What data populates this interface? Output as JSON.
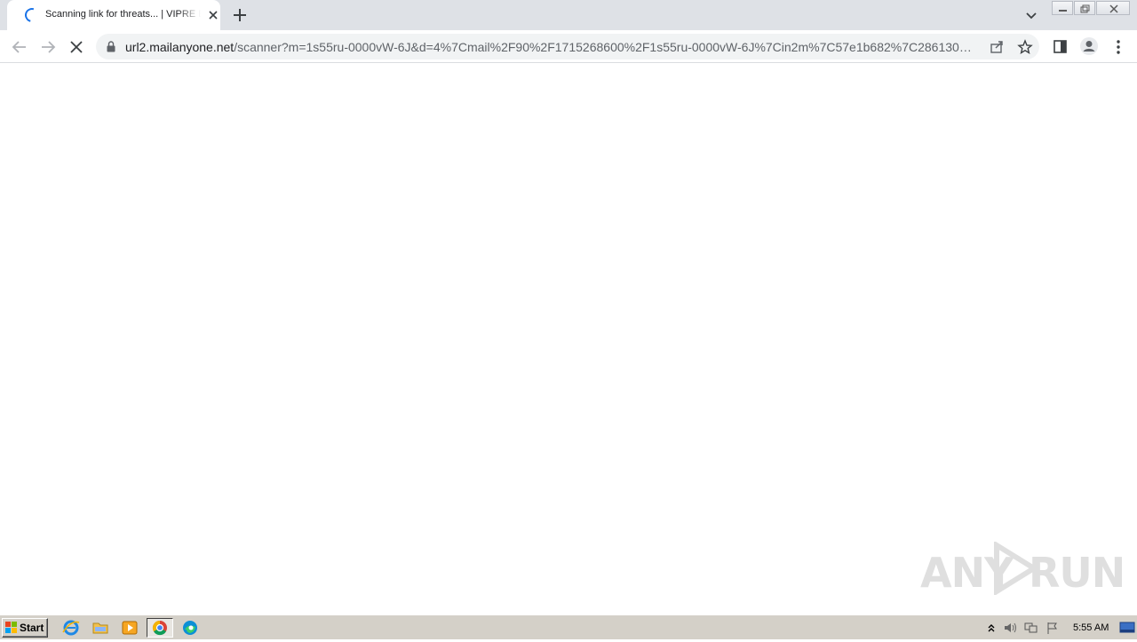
{
  "browser": {
    "tab": {
      "title": "Scanning link for threats... | VIPRE Email Security",
      "loading": true
    },
    "address_bar": {
      "host": "url2.mailanyone.net",
      "path": "/scanner?m=1s55ru-0000vW-6J&d=4%7Cmail%2F90%2F1715268600%2F1s55ru-0000vW-6J%7Cin2m%7C57e1b682%7C286130…"
    },
    "icons": {
      "back": "back-arrow-icon",
      "forward": "forward-arrow-icon",
      "stop": "stop-loading-icon",
      "lock": "lock-icon",
      "share": "share-icon",
      "bookmark": "star-icon",
      "side_panel": "side-panel-icon",
      "profile": "profile-icon",
      "menu": "kebab-menu-icon"
    }
  },
  "watermark": {
    "left": "ANY",
    "right": "RUN"
  },
  "taskbar": {
    "start_label": "Start",
    "apps": [
      "internet-explorer-icon",
      "file-explorer-icon",
      "media-player-icon",
      "chrome-icon",
      "edge-icon"
    ],
    "clock": "5:55 AM"
  },
  "colors": {
    "tabstrip": "#dee1e6",
    "omnibox": "#f1f3f4",
    "taskbar": "#d4d0c8",
    "accent": "#1a73e8"
  }
}
